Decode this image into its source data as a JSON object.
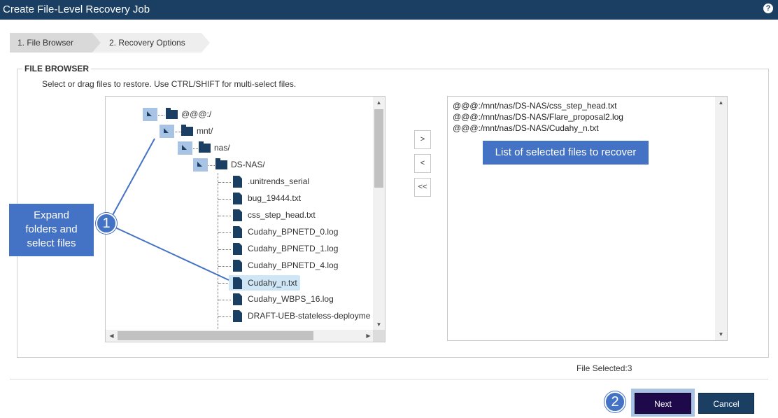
{
  "window": {
    "title": "Create File-Level Recovery Job",
    "help_icon": "question-circle-icon"
  },
  "wizard": {
    "steps": [
      {
        "label": "1. File Browser",
        "active": true
      },
      {
        "label": "2. Recovery Options",
        "active": false
      }
    ]
  },
  "file_browser": {
    "legend": "FILE BROWSER",
    "instructions": "Select or drag files to restore. Use CTRL/SHIFT for multi-select files.",
    "tree": [
      {
        "label": "@@@:/",
        "type": "folder",
        "expanded": true
      },
      {
        "label": "mnt/",
        "type": "folder",
        "expanded": true
      },
      {
        "label": "nas/",
        "type": "folder",
        "expanded": true
      },
      {
        "label": "DS-NAS/",
        "type": "folder",
        "expanded": true
      },
      {
        "label": ".unitrends_serial",
        "type": "file"
      },
      {
        "label": "bug_19444.txt",
        "type": "file"
      },
      {
        "label": "css_step_head.txt",
        "type": "file"
      },
      {
        "label": "Cudahy_BPNETD_0.log",
        "type": "file"
      },
      {
        "label": "Cudahy_BPNETD_1.log",
        "type": "file"
      },
      {
        "label": "Cudahy_BPNETD_4.log",
        "type": "file"
      },
      {
        "label": "Cudahy_n.txt",
        "type": "file",
        "selected": true
      },
      {
        "label": "Cudahy_WBPS_16.log",
        "type": "file"
      },
      {
        "label": "DRAFT-UEB-stateless-deployme",
        "type": "file"
      }
    ]
  },
  "move_buttons": {
    "add": ">",
    "remove": "<",
    "remove_all": "<<"
  },
  "selected_files": [
    "@@@:/mnt/nas/DS-NAS/css_step_head.txt",
    "@@@:/mnt/nas/DS-NAS/Flare_proposal2.log",
    "@@@:/mnt/nas/DS-NAS/Cudahy_n.txt"
  ],
  "annotations": {
    "callout_left_lines": [
      "Expand",
      "folders and",
      "select files"
    ],
    "callout_right": "List of selected files to recover",
    "badge1": "1",
    "badge2": "2"
  },
  "footer": {
    "file_selected": "File Selected:3",
    "next_label": "Next",
    "cancel_label": "Cancel"
  },
  "colors": {
    "title_bar": "#1b3f63",
    "accent": "#4472c4",
    "next_button": "#1e0a4a",
    "selection": "#cfe6f7"
  }
}
